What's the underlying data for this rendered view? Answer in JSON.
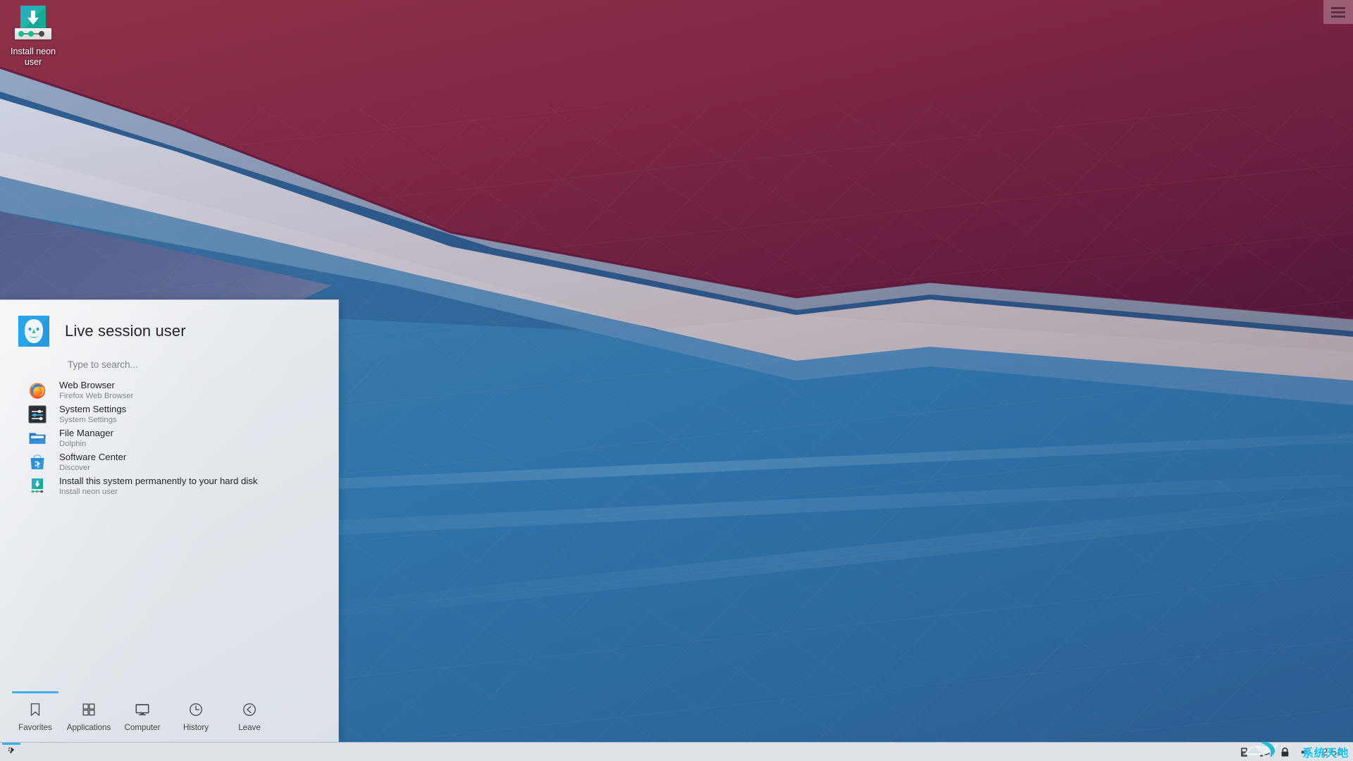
{
  "desktop": {
    "icon": {
      "label": "Install neon user",
      "icon_name": "install-neon-user-icon"
    },
    "toolbox": {
      "icon_name": "hamburger-menu-icon",
      "label": "Desktop Toolbox"
    }
  },
  "kickoff": {
    "user_name": "Live session user",
    "avatar_icon": "user-avatar-icon",
    "search_placeholder": "Type to search...",
    "favorites": [
      {
        "title": "Web Browser",
        "subtitle": "Firefox Web Browser",
        "icon_name": "firefox-icon"
      },
      {
        "title": "System Settings",
        "subtitle": "System Settings",
        "icon_name": "system-settings-icon"
      },
      {
        "title": "File Manager",
        "subtitle": "Dolphin",
        "icon_name": "dolphin-folder-icon"
      },
      {
        "title": "Software Center",
        "subtitle": "Discover",
        "icon_name": "discover-icon"
      },
      {
        "title": "Install this system permanently to your hard disk",
        "subtitle": "Install neon user",
        "icon_name": "install-neon-user-icon"
      }
    ],
    "tabs": [
      {
        "label": "Favorites",
        "icon_name": "bookmark-icon",
        "active": true
      },
      {
        "label": "Applications",
        "icon_name": "grid-icon",
        "active": false
      },
      {
        "label": "Computer",
        "icon_name": "monitor-icon",
        "active": false
      },
      {
        "label": "History",
        "icon_name": "clock-icon",
        "active": false
      },
      {
        "label": "Leave",
        "icon_name": "leave-chevron-icon",
        "active": false
      }
    ]
  },
  "panel": {
    "tasks": [
      {
        "name": "Discover",
        "icon_name": "discover-icon",
        "active": true
      }
    ],
    "tray": [
      {
        "icon_name": "usb-device-icon"
      },
      {
        "icon_name": "network-display-icon"
      },
      {
        "icon_name": "lock-icon"
      },
      {
        "icon_name": "volume-icon"
      }
    ],
    "clock": "2:58",
    "watermark": "系统天地"
  },
  "colors": {
    "accent": "#3daee9",
    "panel_bg": "#dfe3e8",
    "menu_bg": "#e3e7ec",
    "text": "#232629",
    "subtext": "#7f868d",
    "wallpaper_maroon": "#8d2f4a",
    "wallpaper_blue": "#2d6da3",
    "watermark": "#12c3ef"
  }
}
